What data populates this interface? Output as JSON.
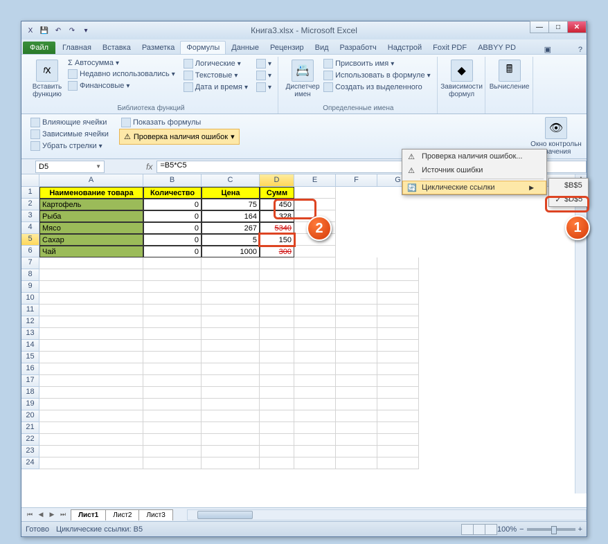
{
  "title": "Книга3.xlsx - Microsoft Excel",
  "qat": {
    "save": "💾",
    "undo": "↶",
    "redo": "↷"
  },
  "tabs": {
    "file": "Файл",
    "items": [
      "Главная",
      "Вставка",
      "Разметка",
      "Формулы",
      "Данные",
      "Рецензир",
      "Вид",
      "Разработч",
      "Надстрой",
      "Foxit PDF",
      "ABBYY PD"
    ],
    "active": "Формулы"
  },
  "ribbon": {
    "insertfn": "Вставить функцию",
    "autosum": "Σ Автосумма",
    "recent": "Недавно использовались",
    "financial": "Финансовые",
    "logical": "Логические",
    "text": "Текстовые",
    "datetime": "Дата и время",
    "lookup_ico": "🔍",
    "math_ico": "θ",
    "more_ico": "📦",
    "lib_label": "Библиотека функций",
    "namemgr": "Диспетчер имен",
    "definename": "Присвоить имя",
    "useinfx": "Использовать в формуле",
    "createfrom": "Создать из выделенного",
    "names_label": "Определенные имена",
    "deps": "Зависимости формул",
    "calc": "Вычисление"
  },
  "ribbon2": {
    "precedents": "Влияющие ячейки",
    "dependents": "Зависимые ячейки",
    "removearrows": "Убрать стрелки",
    "showformulas": "Показать формулы",
    "errorcheck": "Проверка наличия ошибок",
    "watchwindow": "Окно контрольн значения"
  },
  "menu1": {
    "errcheck": "Проверка наличия ошибок...",
    "errsource": "Источник ошибки",
    "circrefs": "Циклические ссылки"
  },
  "menu2": {
    "item1": "$B$5",
    "item2": "$D$5"
  },
  "namebox": "D5",
  "formula": "=B5*C5",
  "columns": [
    "A",
    "B",
    "C",
    "D",
    "E",
    "F",
    "G"
  ],
  "headers": {
    "a": "Наименование товара",
    "b": "Количество",
    "c": "Цена",
    "d": "Сумм"
  },
  "data": [
    {
      "name": "Картофель",
      "qty": "0",
      "price": "75",
      "sum": "450"
    },
    {
      "name": "Рыба",
      "qty": "0",
      "price": "164",
      "sum": "328"
    },
    {
      "name": "Мясо",
      "qty": "0",
      "price": "267",
      "sum": "5340"
    },
    {
      "name": "Сахар",
      "qty": "0",
      "price": "5",
      "sum": "150"
    },
    {
      "name": "Чай",
      "qty": "0",
      "price": "1000",
      "sum": "300"
    }
  ],
  "sheets": [
    "Лист1",
    "Лист2",
    "Лист3"
  ],
  "status": {
    "ready": "Готово",
    "circ": "Циклические ссылки: B5",
    "zoom": "100%"
  },
  "callouts": {
    "c1": "1",
    "c2": "2"
  }
}
